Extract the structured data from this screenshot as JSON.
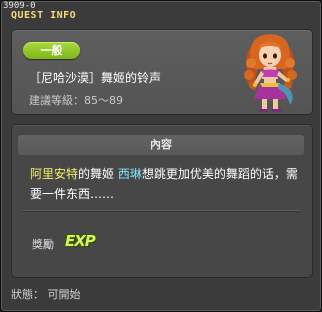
{
  "window": {
    "quest_id": "3909-0",
    "title": "QUEST INFO"
  },
  "info": {
    "badge": "一般",
    "quest_name": "［尼哈沙漠］舞姬的铃声",
    "level_range": "建議等級：85～89"
  },
  "content": {
    "header": "內容",
    "dialog": [
      {
        "text": "阿里安特",
        "style": "yellow"
      },
      {
        "text": "的舞姬 ",
        "style": "normal"
      },
      {
        "text": "西琳",
        "style": "cyan"
      },
      {
        "text": "想跳更加优美的舞蹈的话，需要一件东西……",
        "style": "normal"
      }
    ],
    "reward_label": "獎勵",
    "reward_icon": "EXP"
  },
  "status": {
    "text": "狀態： 可開始"
  },
  "colors": {
    "title": "#f4dd73",
    "badge": "#8cc62a",
    "highlight_place": "#f7ef6a",
    "highlight_npc": "#7fe3f5",
    "exp": "#d7f25a"
  }
}
